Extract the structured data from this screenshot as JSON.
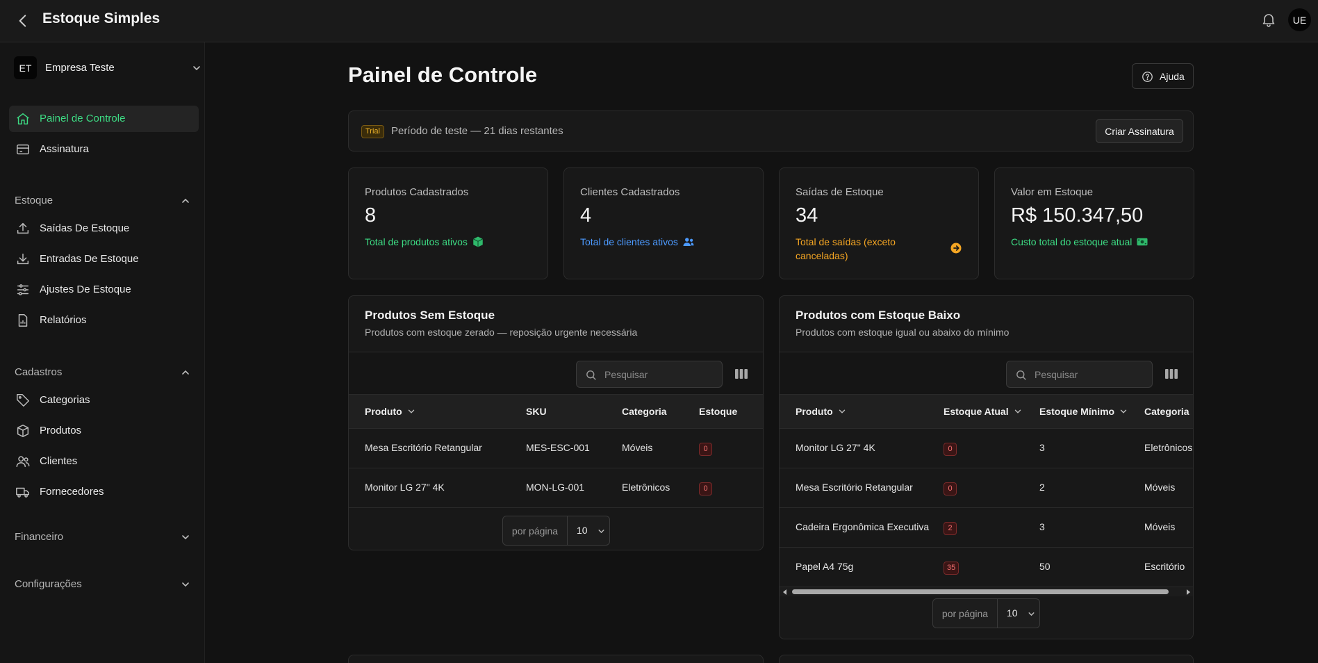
{
  "topbar": {
    "title": "Estoque Simples",
    "avatar": "UE"
  },
  "sidebar": {
    "company": {
      "initials": "ET",
      "name": "Empresa Teste"
    },
    "items": [
      {
        "label": "Painel de Controle"
      },
      {
        "label": "Assinatura"
      }
    ],
    "sections": [
      {
        "label": "Estoque",
        "items": [
          {
            "label": "Saídas De Estoque"
          },
          {
            "label": "Entradas De Estoque"
          },
          {
            "label": "Ajustes De Estoque"
          },
          {
            "label": "Relatórios"
          }
        ]
      },
      {
        "label": "Cadastros",
        "items": [
          {
            "label": "Categorias"
          },
          {
            "label": "Produtos"
          },
          {
            "label": "Clientes"
          },
          {
            "label": "Fornecedores"
          }
        ]
      },
      {
        "label": "Financeiro"
      },
      {
        "label": "Configurações"
      }
    ]
  },
  "main": {
    "title": "Painel de Controle",
    "help_label": "Ajuda",
    "trial": {
      "badge": "Trial",
      "message": "Período de teste — 21 dias restantes",
      "cta": "Criar Assinatura"
    },
    "stats": [
      {
        "title": "Produtos Cadastrados",
        "value": "8",
        "subtitle": "Total de produtos ativos",
        "color": "#3ddc84"
      },
      {
        "title": "Clientes Cadastrados",
        "value": "4",
        "subtitle": "Total de clientes ativos",
        "color": "#4c9aff"
      },
      {
        "title": "Saídas de Estoque",
        "value": "34",
        "subtitle_line1": "Total de saídas (exceto",
        "subtitle_line2": "canceladas)",
        "color": "#f5a623"
      },
      {
        "title": "Valor em Estoque",
        "value": "R$ 150.347,50",
        "subtitle": "Custo total do estoque atual",
        "color": "#3ddc84"
      }
    ],
    "no_stock": {
      "title": "Produtos Sem Estoque",
      "subtitle": "Produtos com estoque zerado — reposição urgente necessária",
      "search_placeholder": "Pesquisar",
      "columns": [
        "Produto",
        "SKU",
        "Categoria",
        "Estoque"
      ],
      "rows": [
        {
          "produto": "Mesa Escritório Retangular",
          "sku": "MES-ESC-001",
          "categoria": "Móveis",
          "estoque": "0"
        },
        {
          "produto": "Monitor LG 27\" 4K",
          "sku": "MON-LG-001",
          "categoria": "Eletrônicos",
          "estoque": "0"
        }
      ],
      "per_page_label": "por página",
      "per_page_value": "10"
    },
    "low_stock": {
      "title": "Produtos com Estoque Baixo",
      "subtitle": "Produtos com estoque igual ou abaixo do mínimo",
      "search_placeholder": "Pesquisar",
      "columns": [
        "Produto",
        "Estoque Atual",
        "Estoque Mínimo",
        "Categoria"
      ],
      "rows": [
        {
          "produto": "Monitor LG 27\" 4K",
          "atual": "0",
          "minimo": "3",
          "categoria": "Eletrônicos"
        },
        {
          "produto": "Mesa Escritório Retangular",
          "atual": "0",
          "minimo": "2",
          "categoria": "Móveis"
        },
        {
          "produto": "Cadeira Ergonômica Executiva",
          "atual": "2",
          "minimo": "3",
          "categoria": "Móveis"
        },
        {
          "produto": "Papel A4 75g",
          "atual": "35",
          "minimo": "50",
          "categoria": "Escritório"
        }
      ],
      "per_page_label": "por página",
      "per_page_value": "10"
    }
  }
}
